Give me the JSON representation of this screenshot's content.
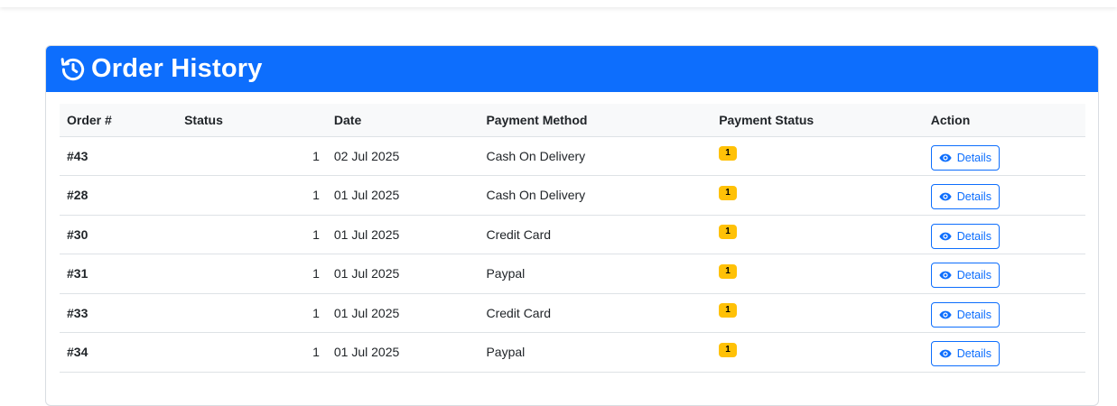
{
  "header": {
    "title": "Order History",
    "icon": "history-icon"
  },
  "table": {
    "columns": [
      "Order #",
      "Status",
      "Date",
      "Payment Method",
      "Payment Status",
      "Action"
    ],
    "rows": [
      {
        "order": "#43",
        "status": "1",
        "date": "02 Jul 2025",
        "payment_method": "Cash On Delivery",
        "payment_status": "1",
        "action": "Details"
      },
      {
        "order": "#28",
        "status": "1",
        "date": "01 Jul 2025",
        "payment_method": "Cash On Delivery",
        "payment_status": "1",
        "action": "Details"
      },
      {
        "order": "#30",
        "status": "1",
        "date": "01 Jul 2025",
        "payment_method": "Credit Card",
        "payment_status": "1",
        "action": "Details"
      },
      {
        "order": "#31",
        "status": "1",
        "date": "01 Jul 2025",
        "payment_method": "Paypal",
        "payment_status": "1",
        "action": "Details"
      },
      {
        "order": "#33",
        "status": "1",
        "date": "01 Jul 2025",
        "payment_method": "Credit Card",
        "payment_status": "1",
        "action": "Details"
      },
      {
        "order": "#34",
        "status": "1",
        "date": "01 Jul 2025",
        "payment_method": "Paypal",
        "payment_status": "1",
        "action": "Details"
      }
    ]
  },
  "colors": {
    "primary": "#0d6efd",
    "badge_warning": "#ffc107",
    "header_row_bg": "#f8f9fa"
  }
}
